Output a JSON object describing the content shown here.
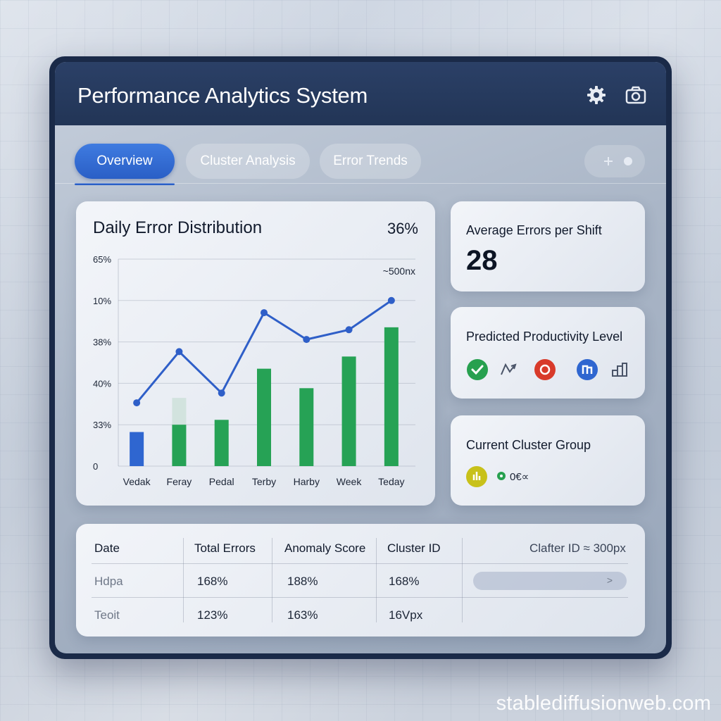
{
  "header": {
    "title": "Performance Analytics System",
    "settings_icon": "gear-icon",
    "camera_icon": "camera-icon"
  },
  "tabs": [
    {
      "label": "Overview",
      "active": true
    },
    {
      "label": "Cluster Analysis",
      "active": false
    },
    {
      "label": "Error Trends",
      "active": false
    }
  ],
  "tab_control": {
    "icons": [
      "plus-icon",
      "dot-icon"
    ]
  },
  "chart_card": {
    "title": "Daily Error Distribution",
    "percent": "36%"
  },
  "chart_data": {
    "type": "bar",
    "title": "Daily Error Distribution",
    "categories": [
      "Vedak",
      "Feray",
      "Pedal",
      "Terby",
      "Harby",
      "Week",
      "Teday"
    ],
    "y_tick_labels": [
      "0",
      "33%",
      "40%",
      "38%",
      "10%",
      "65%"
    ],
    "annotation": "~500nx",
    "series": [
      {
        "type": "bar",
        "values": [
          1.4,
          1.7,
          1.9,
          4.0,
          3.2,
          4.5,
          5.7
        ],
        "colors": [
          "#2f66d0",
          "#26a255",
          "#26a255",
          "#26a255",
          "#26a255",
          "#26a255",
          "#26a255"
        ]
      },
      {
        "type": "line",
        "values": [
          2.6,
          4.7,
          3.0,
          6.3,
          5.2,
          5.6,
          6.8
        ],
        "color": "#2f5fc8"
      }
    ],
    "ghost_bar": {
      "category": "Feray",
      "value": 2.8
    },
    "ylim": [
      0,
      8.5
    ],
    "grid": true
  },
  "stat_avg": {
    "label": "Average Errors per Shift",
    "value": "28"
  },
  "stat_prod": {
    "label": "Predicted Productivity Level",
    "icons": [
      "check-circle-icon",
      "trend-arrow-icon",
      "alert-circle-icon",
      "user-circle-icon",
      "bar-steps-icon"
    ],
    "colors": {
      "green": "#27a04f",
      "red": "#d83a2a",
      "blue": "#2f66d0"
    }
  },
  "stat_cluster": {
    "label": "Current Cluster Group",
    "badge_icon": "cluster-badge-icon",
    "badge_color": "#c8c11a",
    "status_text": "0€∝"
  },
  "table": {
    "headers": [
      "Date",
      "Total Errors",
      "Anomaly Score",
      "Cluster ID",
      "Clafter ID ≈ 300px"
    ],
    "rows": [
      [
        "Hdpa",
        "168%",
        "188%",
        "168%"
      ],
      [
        "Teoit",
        "123%",
        "163%",
        "16Vpx"
      ]
    ]
  },
  "watermark": "stablediffusionweb.com"
}
